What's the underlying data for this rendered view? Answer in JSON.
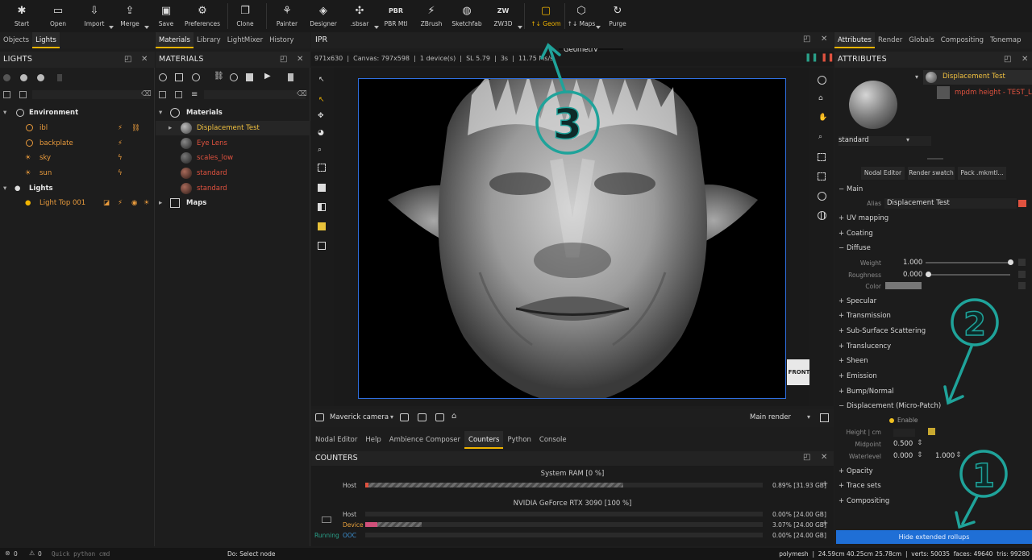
{
  "toolbar": {
    "items": [
      {
        "label": "Start",
        "icon": "asterisk-icon"
      },
      {
        "label": "Open",
        "icon": "folder-icon"
      },
      {
        "label": "Import",
        "icon": "import-icon"
      },
      {
        "label": "Merge",
        "icon": "merge-icon"
      },
      {
        "label": "Save",
        "icon": "save-icon"
      },
      {
        "label": "Preferences",
        "icon": "gear-icon"
      },
      {
        "label": "Clone",
        "icon": "clone-icon"
      },
      {
        "label": "Painter",
        "icon": "painter-icon"
      },
      {
        "label": "Designer",
        "icon": "designer-icon"
      },
      {
        "label": ".sbsar",
        "icon": "sbsar-icon"
      },
      {
        "label": "PBR Mtl",
        "icon": "pbr-icon",
        "glyph": "PBR"
      },
      {
        "label": "ZBrush",
        "icon": "zbrush-icon"
      },
      {
        "label": "Sketchfab",
        "icon": "sketchfab-icon"
      },
      {
        "label": "ZW3D",
        "icon": "zw3d-icon",
        "glyph": "ZW"
      },
      {
        "label": "↑↓ Geom",
        "icon": "reload-geometry-icon"
      },
      {
        "label": "↑↓ Maps",
        "icon": "maps-icon"
      },
      {
        "label": "Purge",
        "icon": "purge-icon"
      }
    ],
    "tooltip": "Reload Geometry",
    "accent": "#f0b400"
  },
  "left_tabs": [
    "Objects",
    "Lights"
  ],
  "left_tab_active": "Lights",
  "lights_panel": {
    "title": "LIGHTS",
    "tree": [
      {
        "label": "Environment",
        "kind": "group"
      },
      {
        "label": "ibl",
        "kind": "item"
      },
      {
        "label": "backplate",
        "kind": "item"
      },
      {
        "label": "sky",
        "kind": "item"
      },
      {
        "label": "sun",
        "kind": "item"
      },
      {
        "label": "Lights",
        "kind": "group"
      },
      {
        "label": "Light Top 001",
        "kind": "item"
      }
    ]
  },
  "mid_tabs": [
    "Materials",
    "Library",
    "LightMixer",
    "History"
  ],
  "mid_tab_active": "Materials",
  "materials_panel": {
    "title": "MATERIALS",
    "tree": [
      {
        "label": "Materials",
        "kind": "group"
      },
      {
        "label": "Displacement Test",
        "kind": "selected"
      },
      {
        "label": "Eye Lens",
        "kind": "red"
      },
      {
        "label": "scales_low",
        "kind": "red"
      },
      {
        "label": "standard",
        "kind": "red"
      },
      {
        "label": "standard",
        "kind": "red"
      },
      {
        "label": "Maps",
        "kind": "group"
      }
    ]
  },
  "ipr": {
    "title": "IPR",
    "status": "971x630  |  Canvas: 797x598  |  1 device(s)  |  SL 5.79  |  3s  |  11.75 Ms/s",
    "cube_label": "FRONT",
    "camera": "Maverick camera",
    "render_mode": "Main render",
    "frame_color": "#2f6fe0"
  },
  "bottom_tabs": [
    "Nodal Editor",
    "Help",
    "Ambience Composer",
    "Counters",
    "Python",
    "Console"
  ],
  "bottom_tab_active": "Counters",
  "counters": {
    "title": "COUNTERS",
    "system_ram": "System RAM  [0 %]",
    "host_label": "Host",
    "host_value": "0.89% [31.93 GB]",
    "host_fill": 0.0089,
    "gpu": "NVIDIA GeForce RTX 3090  [100 %]",
    "gpu_rows": [
      {
        "label": "Host",
        "value": "0.00% [24.00 GB]",
        "fill": 0.0,
        "color": "#e0523f"
      },
      {
        "label": "Device",
        "value": "3.07% [24.00 GB]",
        "fill": 0.0307,
        "color": "#e8a03c"
      },
      {
        "label": "OOC",
        "value": "0.00% [24.00 GB]",
        "fill": 0.0,
        "color": "#3c8fd0"
      }
    ],
    "running": "Running"
  },
  "right_tabs": [
    "Attributes",
    "Render",
    "Globals",
    "Compositing",
    "Tonemap"
  ],
  "right_tab_active": "Attributes",
  "attributes": {
    "title": "ATTRIBUTES",
    "material_name": "Displacement Test",
    "map_name": "mpdm height - TEST_L...",
    "shader": "standard",
    "buttons": [
      "Nodal Editor",
      "Render swatch",
      "Pack .mkmtl..."
    ],
    "main": "Main",
    "alias_label": "Alias",
    "alias_value": "Displacement Test",
    "alias_color": "#e0523f",
    "sections_top": [
      "UV mapping",
      "Coating"
    ],
    "diffuse": {
      "title": "Diffuse",
      "weight_label": "Weight",
      "weight": "1.000",
      "weight_fill": 1.0,
      "roughness_label": "Roughness",
      "roughness": "0.000",
      "roughness_fill": 0.0,
      "color_label": "Color"
    },
    "sections_mid": [
      "Specular",
      "Transmission",
      "Sub-Surface Scattering",
      "Translucency",
      "Sheen",
      "Emission",
      "Bump/Normal"
    ],
    "displacement": {
      "title": "Displacement (Micro-Patch)",
      "enable": "Enable",
      "height_label": "Height | cm",
      "midpoint_label": "Midpoint",
      "midpoint": "0.500",
      "waterlevel_label": "Waterlevel",
      "waterlevel_min": "0.000",
      "waterlevel_max": "1.000"
    },
    "sections_bottom": [
      "Opacity",
      "Trace sets",
      "Compositing"
    ],
    "hide_button": "Hide extended rollups",
    "hide_color": "#1f6fd6"
  },
  "annotations": [
    "3",
    "2",
    "1"
  ],
  "annotation_color": "#1fa39a",
  "statusbar": {
    "count1": "0",
    "count2": "0",
    "python_placeholder": "Quick python cmd",
    "hint": "Do: Select node",
    "info": "polymesh  |  24.59cm 40.25cm 25.78cm  |  verts: 50035  faces: 49640  tris: 99280"
  }
}
